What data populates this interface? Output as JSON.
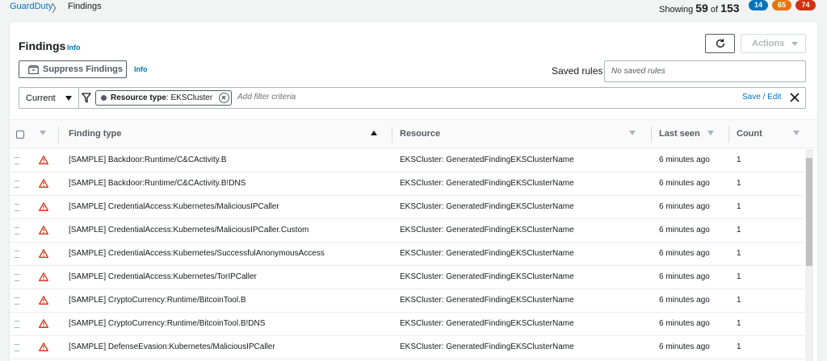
{
  "breadcrumb": {
    "parent": "GuardDuty",
    "separator": "〉",
    "current": "Findings"
  },
  "summary": {
    "showing_prefix": "Showing",
    "showing_count": "59",
    "of_label": "of",
    "total": "153",
    "badges": [
      {
        "value": "14",
        "color": "#0073bb"
      },
      {
        "value": "65",
        "color": "#ec7211"
      },
      {
        "value": "74",
        "color": "#d13212"
      }
    ]
  },
  "header": {
    "title": "Findings",
    "info": "Info",
    "actions_label": "Actions"
  },
  "toolbar": {
    "suppress_label": "Suppress Findings",
    "suppress_info": "Info"
  },
  "saved_rules": {
    "label": "Saved rules",
    "placeholder": "No saved rules"
  },
  "filter": {
    "scope": "Current",
    "token_key": "Resource type",
    "token_value": ": EKSCluster",
    "input_placeholder": "Add filter criteria",
    "save_edit": "Save / Edit"
  },
  "table": {
    "columns": [
      "Finding type",
      "Resource",
      "Last seen",
      "Count"
    ],
    "rows": [
      {
        "finding_type": "[SAMPLE] Backdoor:Runtime/C&CActivity.B",
        "resource": "EKSCluster: GeneratedFindingEKSClusterName",
        "last_seen": "6 minutes ago",
        "count": "1"
      },
      {
        "finding_type": "[SAMPLE] Backdoor:Runtime/C&CActivity.B!DNS",
        "resource": "EKSCluster: GeneratedFindingEKSClusterName",
        "last_seen": "6 minutes ago",
        "count": "1"
      },
      {
        "finding_type": "[SAMPLE] CredentialAccess:Kubernetes/MaliciousIPCaller",
        "resource": "EKSCluster: GeneratedFindingEKSClusterName",
        "last_seen": "6 minutes ago",
        "count": "1"
      },
      {
        "finding_type": "[SAMPLE] CredentialAccess:Kubernetes/MaliciousIPCaller.Custom",
        "resource": "EKSCluster: GeneratedFindingEKSClusterName",
        "last_seen": "6 minutes ago",
        "count": "1"
      },
      {
        "finding_type": "[SAMPLE] CredentialAccess:Kubernetes/SuccessfulAnonymousAccess",
        "resource": "EKSCluster: GeneratedFindingEKSClusterName",
        "last_seen": "6 minutes ago",
        "count": "1"
      },
      {
        "finding_type": "[SAMPLE] CredentialAccess:Kubernetes/TorIPCaller",
        "resource": "EKSCluster: GeneratedFindingEKSClusterName",
        "last_seen": "6 minutes ago",
        "count": "1"
      },
      {
        "finding_type": "[SAMPLE] CryptoCurrency:Runtime/BitcoinTool.B",
        "resource": "EKSCluster: GeneratedFindingEKSClusterName",
        "last_seen": "6 minutes ago",
        "count": "1"
      },
      {
        "finding_type": "[SAMPLE] CryptoCurrency:Runtime/BitcoinTool.B!DNS",
        "resource": "EKSCluster: GeneratedFindingEKSClusterName",
        "last_seen": "6 minutes ago",
        "count": "1"
      },
      {
        "finding_type": "[SAMPLE] DefenseEvasion:Kubernetes/MaliciousIPCaller",
        "resource": "EKSCluster: GeneratedFindingEKSClusterName",
        "last_seen": "6 minutes ago",
        "count": "1"
      }
    ]
  },
  "icons": {
    "severity": "warning-triangle-icon",
    "refresh": "refresh-icon",
    "filter": "funnel-icon",
    "clear": "close-icon",
    "suppress": "suppress-icon"
  },
  "colors": {
    "link": "#0073bb",
    "severity_high": "#d13212"
  }
}
